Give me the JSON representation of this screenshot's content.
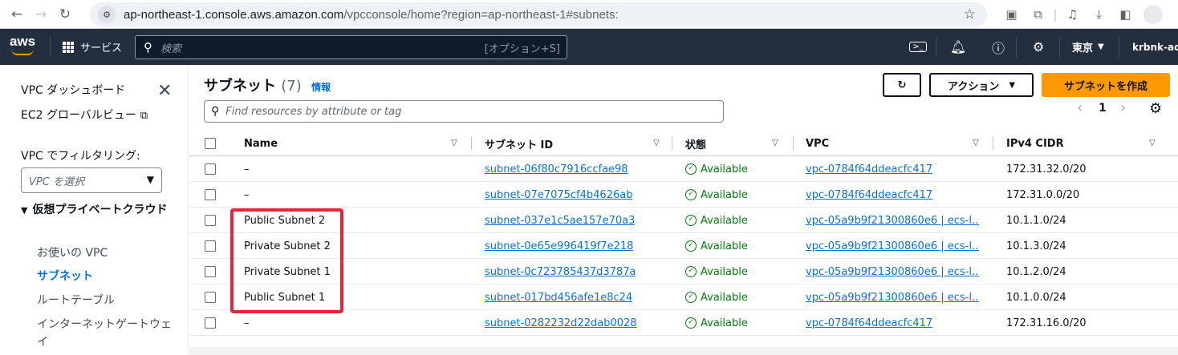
{
  "browser": {
    "url_host": "ap-northeast-1.console.aws.amazon.com",
    "url_path": "/vpcconsole/home?region=ap-northeast-1#subnets:"
  },
  "aws": {
    "logo": "aws",
    "services_label": "サービス",
    "search_placeholder": "検索",
    "search_shortcut": "[オプション+S]",
    "region": "東京",
    "account": "krbnk-adm"
  },
  "sidebar": {
    "dashboard": "VPC ダッシュボード",
    "ec2_global": "EC2 グローバルビュー",
    "filter_label": "VPC でフィルタリング:",
    "filter_placeholder": "VPC を選択",
    "section": "仮想プライベートクラウド",
    "items": [
      "お使いの VPC",
      "サブネット",
      "ルートテーブル",
      "インターネットゲートウェイ"
    ]
  },
  "main": {
    "title": "サブネット",
    "count": "(7)",
    "info": "情報",
    "actions": "アクション",
    "create": "サブネットを作成",
    "filter_placeholder": "Find resources by attribute or tag",
    "page": "1"
  },
  "table": {
    "headers": [
      "Name",
      "サブネット ID",
      "状態",
      "VPC",
      "IPv4 CIDR"
    ],
    "rows": [
      {
        "name": "–",
        "id": "subnet-06f80c7916ccfae98",
        "state": "Available",
        "vpc": "vpc-0784f64ddeacfc417",
        "cidr": "172.31.32.0/20"
      },
      {
        "name": "–",
        "id": "subnet-07e7075cf4b4626ab",
        "state": "Available",
        "vpc": "vpc-0784f64ddeacfc417",
        "cidr": "172.31.0.0/20"
      },
      {
        "name": "Public Subnet 2",
        "id": "subnet-037e1c5ae157e70a3",
        "state": "Available",
        "vpc": "vpc-05a9b9f21300860e6 | ecs-l...",
        "cidr": "10.1.1.0/24"
      },
      {
        "name": "Private Subnet 2",
        "id": "subnet-0e65e996419f7e218",
        "state": "Available",
        "vpc": "vpc-05a9b9f21300860e6 | ecs-l...",
        "cidr": "10.1.3.0/24"
      },
      {
        "name": "Private Subnet 1",
        "id": "subnet-0c723785437d3787a",
        "state": "Available",
        "vpc": "vpc-05a9b9f21300860e6 | ecs-l...",
        "cidr": "10.1.2.0/24"
      },
      {
        "name": "Public Subnet 1",
        "id": "subnet-017bd456afe1e8c24",
        "state": "Available",
        "vpc": "vpc-05a9b9f21300860e6 | ecs-l...",
        "cidr": "10.1.0.0/24"
      },
      {
        "name": "–",
        "id": "subnet-0282232d22dab0028",
        "state": "Available",
        "vpc": "vpc-0784f64ddeacfc417",
        "cidr": "172.31.16.0/20"
      }
    ]
  },
  "colors": {
    "aws_nav": "#232f3e",
    "primary_button": "#ff9900",
    "link": "#0972d3",
    "available": "#037f0c",
    "highlight": "#e8243c"
  }
}
